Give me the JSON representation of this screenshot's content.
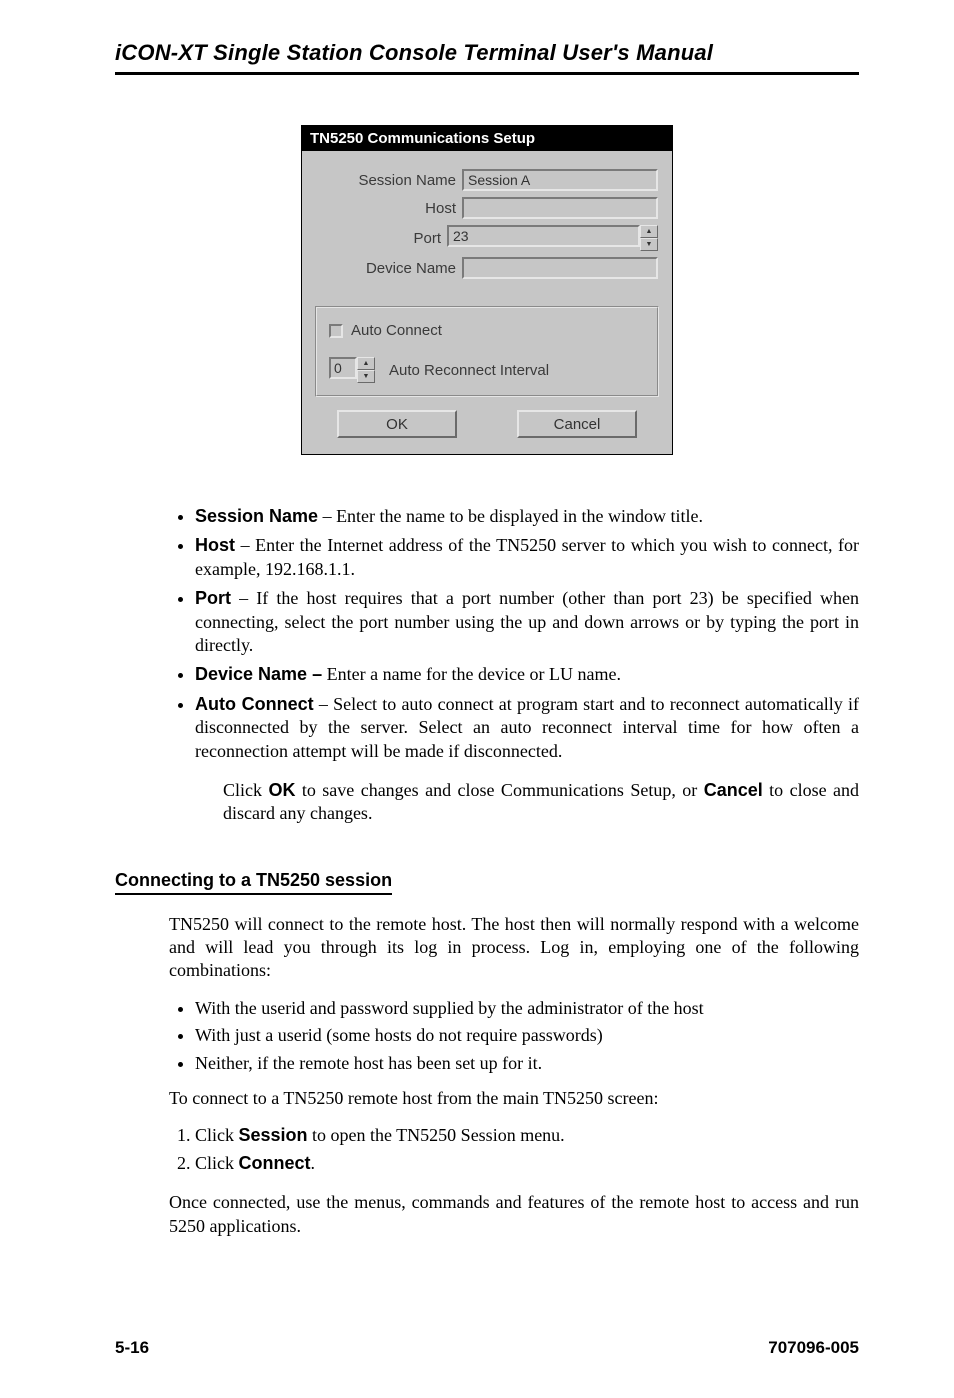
{
  "header": {
    "title": "iCON-XT Single Station Console Terminal User's Manual"
  },
  "dialog": {
    "title": "TN5250 Communications Setup",
    "labels": {
      "session_name": "Session Name",
      "host": "Host",
      "port": "Port",
      "device_name": "Device Name",
      "auto_connect": "Auto Connect",
      "auto_reconnect_interval": "Auto Reconnect Interval"
    },
    "values": {
      "session_name": "Session A",
      "host": "",
      "port": "23",
      "device_name": "",
      "auto_reconnect_interval": "0"
    },
    "buttons": {
      "ok": "OK",
      "cancel": "Cancel"
    }
  },
  "list": {
    "session_name": {
      "term": "Session Name",
      "text": " – Enter the name to be displayed in the window title."
    },
    "host": {
      "term": "Host",
      "text": " – Enter the Internet address of the TN5250 server to which you wish to connect, for example, 192.168.1.1."
    },
    "port": {
      "term": "Port",
      "text": " – If the host requires that a port number (other than port 23) be specified when connecting, select the port number using the up and down arrows or by typing the port in directly."
    },
    "device_name": {
      "term": "Device Name –",
      "text": " Enter a name for the device or LU name."
    },
    "auto_connect": {
      "term": "Auto Connect",
      "text": " – Select to auto connect at program start and to reconnect automatically if disconnected by the server. Select an auto reconnect interval time for how often a reconnection attempt will be made if disconnected."
    }
  },
  "paras": {
    "ok_cancel_pre": "Click ",
    "ok_cancel_mid": " to save changes and close Communications Setup, or ",
    "ok_cancel_post": " to close and discard any changes.",
    "bold_ok": "OK",
    "bold_cancel": "Cancel"
  },
  "section2": {
    "heading": "Connecting to a TN5250 session",
    "intro": "TN5250 will connect to the remote host. The host then will normally respond with a welcome and will lead you through its log in process. Log in, employing one of the following combinations:",
    "options": [
      "With the userid and password supplied by the administrator of the host",
      "With just a userid (some hosts do not require passwords)",
      "Neither, if the remote host has been set up for it."
    ],
    "connect_intro": "To connect to a TN5250 remote host from the main TN5250 screen:",
    "steps": {
      "1": {
        "pre": "Click ",
        "bold": "Session",
        "post": " to open the TN5250 Session menu."
      },
      "2": {
        "pre": "Click ",
        "bold": "Connect",
        "post": "."
      }
    },
    "outro": "Once connected, use the menus, commands and features of the remote host to access and run 5250 applications."
  },
  "footer": {
    "page": "5-16",
    "doc": "707096-005"
  }
}
